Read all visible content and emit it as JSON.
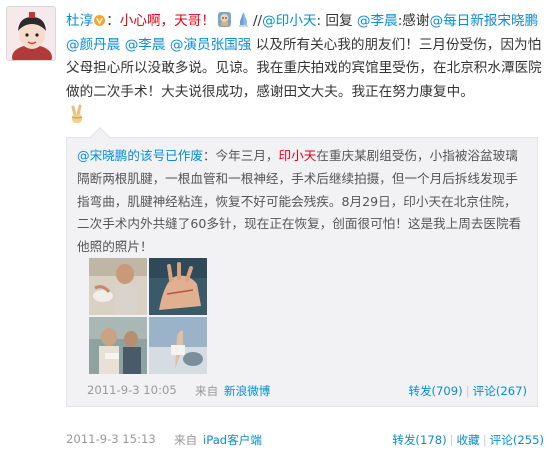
{
  "post": {
    "author": "杜淳",
    "text_1": "：",
    "text_red": "小心啊，天哥！",
    "text_2": "//",
    "mention_xiaotian": "@印小天",
    "text_3": ": 回复 ",
    "mention_lichen": "@李晨",
    "text_4": ":感谢",
    "mention_meiri": "@每日新报宋晓鹏",
    "text_5": " ",
    "mention_yandan": "@颜丹晨",
    "text_6": " ",
    "mention_lichen2": "@李晨",
    "text_7": " ",
    "mention_zhang": "@演员张国强",
    "text_8": " 以及所有关心我的朋友们！三月份受伤，因为怕父母担心所以没敢多说。见谅。我在重庆拍戏的宾馆里受伤，在北京积水潭医院做的二次手术！大夫说很成功，感谢田文大夫。我正在努力康复中。",
    "footer": {
      "time": "2011-9-3 15:13",
      "from": "来自",
      "via": "iPad客户端",
      "repost_label": "转发(178)",
      "favorite_label": "收藏",
      "comment_label": "评论(255)"
    }
  },
  "repost": {
    "author": "@宋晓鹏的该号已作废",
    "text_1": "：今年三月，",
    "name_red": "印小天",
    "text_2": "在重庆某剧组受伤，小指被浴盆玻璃隔断两根肌腱，一根血管和一根神经，手术后继续拍摄，但一个月后拆线发现手指弯曲，肌腱神经粘连，恢复不好可能会残疾。8月29日，印小天在北京住院，二次手术内外共缝了60多针，现在正在恢复，创面很可怕！这是我上周去医院看他照的照片！",
    "footer": {
      "time": "2011-9-3 10:05",
      "from": "来自",
      "via": "新浪微博",
      "repost_label": "转发(709)",
      "comment_label": "评论(267)"
    }
  },
  "icons": {
    "vip": "v-badge-icon",
    "emoji": "face-emoji-icon",
    "victory": "victory-hand-icon"
  },
  "colors": {
    "link": "#0a8cd2",
    "highlight": "#e60012",
    "repost_bg": "#f2f2f5"
  }
}
